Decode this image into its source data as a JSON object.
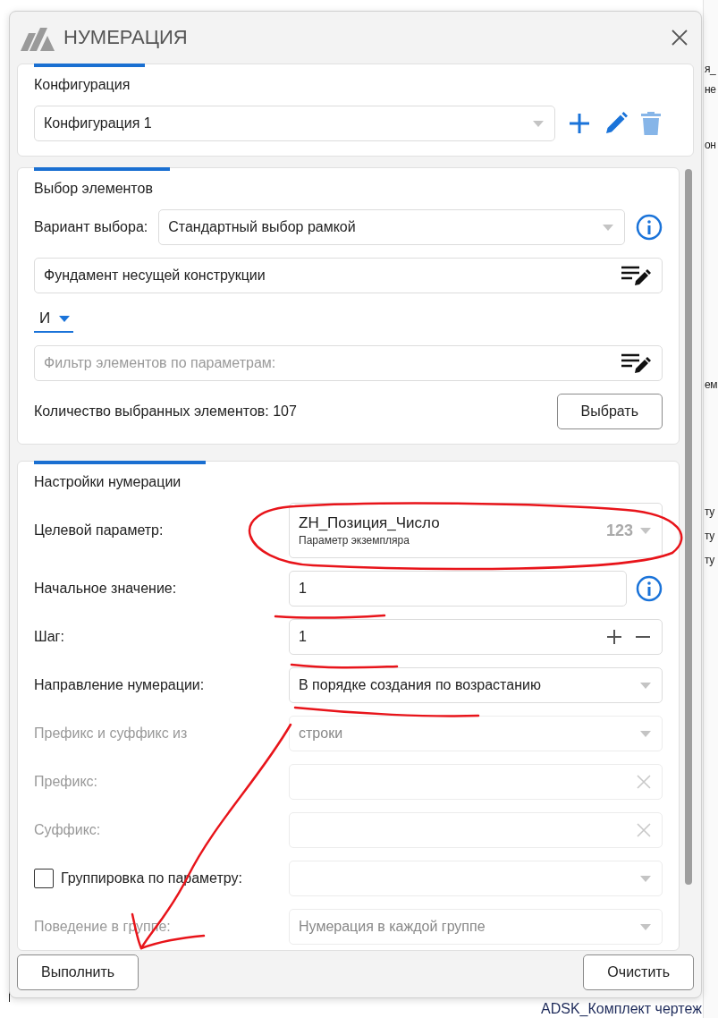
{
  "background": {
    "fragments": [
      {
        "text": "я_"
      },
      {
        "text": "не"
      },
      {
        "text": "он"
      },
      {
        "text": "ем"
      },
      {
        "text": "ту"
      },
      {
        "text": "ту"
      },
      {
        "text": "ту"
      }
    ],
    "bottom_text": "ADSK_Комплект чертеж"
  },
  "window": {
    "title": "НУМЕРАЦИЯ"
  },
  "configuration": {
    "title": "Конфигурация",
    "value": "Конфигурация 1"
  },
  "selection": {
    "title": "Выбор элементов",
    "variant_label": "Вариант выбора:",
    "variant_value": "Стандартный выбор рамкой",
    "filter_value": "Фундамент несущей конструкции",
    "logic": "И",
    "filter_placeholder": "Фильтр элементов по параметрам:",
    "count": "Количество выбранных элементов: 107",
    "select_button": "Выбрать"
  },
  "numbering": {
    "title": "Настройки нумерации",
    "rows": [
      {
        "kind": "param",
        "label": "Целевой параметр:",
        "value": "ZH_Позиция_Число",
        "sub": "Параметр экземпляра",
        "type_badge": "123",
        "disabled": false
      },
      {
        "kind": "info",
        "label": "Начальное значение:",
        "value": "1",
        "disabled": false
      },
      {
        "kind": "stepper",
        "label": "Шаг:",
        "value": "1",
        "disabled": false
      },
      {
        "kind": "dropdown",
        "label": "Направление нумерации:",
        "value": "В порядке создания по возрастанию",
        "disabled": false
      },
      {
        "kind": "dropdown",
        "label": "Префикс и суффикс из",
        "value": "строки",
        "disabled": true
      },
      {
        "kind": "clearable",
        "label": "Префикс:",
        "disabled": true
      },
      {
        "kind": "clearable",
        "label": "Суффикс:",
        "disabled": true
      },
      {
        "kind": "checkbox",
        "label": "Группировка по параметру:",
        "checked": false,
        "disabled": false
      },
      {
        "kind": "dropdown",
        "label": "Поведение в группе:",
        "value": "Нумерация в каждой группе",
        "disabled": true
      }
    ]
  },
  "buttons": {
    "run": "Выполнить",
    "clear": "Очистить"
  }
}
